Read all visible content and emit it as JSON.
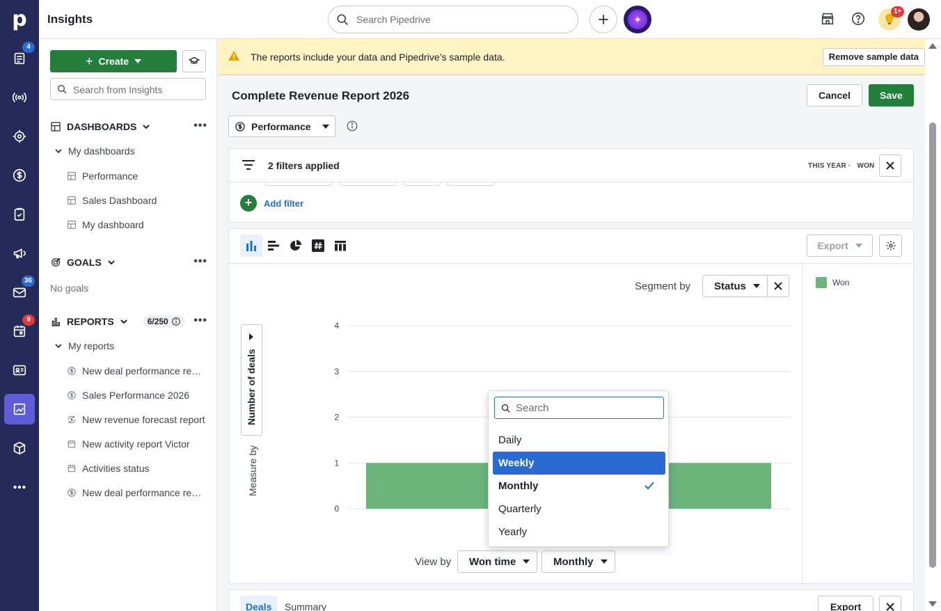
{
  "app": {
    "logo": "p",
    "title": "Insights"
  },
  "rail": {
    "badges": {
      "leads": "4",
      "mail": "36",
      "activities": "9"
    }
  },
  "topbar": {
    "search_placeholder": "Search Pipedrive",
    "notifications_badge": "1+"
  },
  "sidebar": {
    "create_label": "Create",
    "search_placeholder": "Search from Insights",
    "dashboards": {
      "title": "DASHBOARDS",
      "group": "My dashboards",
      "items": [
        {
          "label": "Performance"
        },
        {
          "label": "Sales Dashboard"
        },
        {
          "label": "My dashboard"
        }
      ]
    },
    "goals": {
      "title": "GOALS",
      "empty": "No goals"
    },
    "reports": {
      "title": "REPORTS",
      "count": "6/250",
      "group": "My reports",
      "items": [
        {
          "label": "New deal performance report",
          "icon": "dollar-icon"
        },
        {
          "label": "Sales Performance 2026",
          "icon": "dollar-icon"
        },
        {
          "label": "New revenue forecast report",
          "icon": "refresh-dollar-icon"
        },
        {
          "label": "New activity report Victor",
          "icon": "calendar-icon"
        },
        {
          "label": "Activities status",
          "icon": "calendar-icon"
        },
        {
          "label": "New deal performance report",
          "icon": "dollar-icon"
        }
      ]
    }
  },
  "banner": {
    "text": "The reports include your data and Pipedrive’s sample data.",
    "remove_label": "Remove sample data"
  },
  "report": {
    "title": "Complete Revenue Report 2026",
    "cancel_label": "Cancel",
    "save_label": "Save",
    "dashboard_label": "Performance"
  },
  "filters": {
    "summary": "2 filters applied",
    "tag_period": "THIS YEAR",
    "tag_status": "WON",
    "add_label": "Add filter"
  },
  "chart_panel": {
    "export_label": "Export",
    "segment_label": "Segment by",
    "segment_value": "Status",
    "measure_by_label": "Measure by",
    "measure_value": "Number of deals",
    "view_by_label": "View by",
    "view_by_field": "Won time",
    "view_by_interval": "Monthly"
  },
  "chart_data": {
    "type": "bar",
    "y_ticks": [
      "0",
      "1",
      "2",
      "3",
      "4"
    ],
    "ylim": [
      0,
      4
    ],
    "series": [
      {
        "name": "Won",
        "color": "#6db37c",
        "values": [
          1,
          1
        ]
      }
    ],
    "legend": "right"
  },
  "interval_dropdown": {
    "search_placeholder": "Search",
    "options": [
      {
        "label": "Daily"
      },
      {
        "label": "Weekly"
      },
      {
        "label": "Monthly"
      },
      {
        "label": "Quarterly"
      },
      {
        "label": "Yearly"
      }
    ],
    "highlighted": "Weekly",
    "selected": "Monthly"
  },
  "bottom": {
    "tab_deals": "Deals",
    "tab_summary": "Summary",
    "export_label": "Export"
  },
  "colors": {
    "rail": "#262a5a",
    "accent_green": "#247e3c",
    "highlight_blue": "#2a6bd1",
    "bar_green": "#6db37c"
  }
}
